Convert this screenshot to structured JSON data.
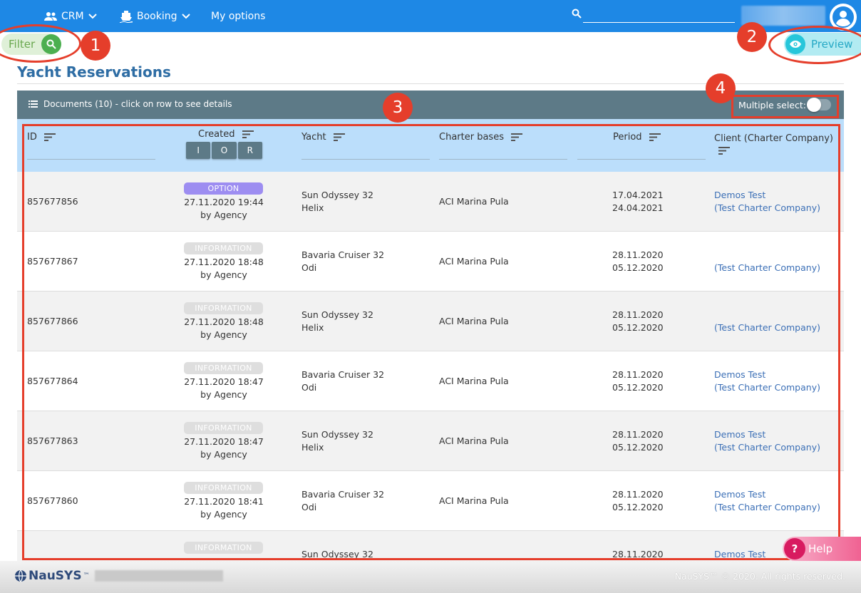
{
  "nav": {
    "crm": "CRM",
    "booking": "Booking",
    "my_options": "My options",
    "search_placeholder": ""
  },
  "filter_label": "Filter",
  "preview_label": "Preview",
  "page_title": "Yacht Reservations",
  "documents_label": "Documents (10) - click on row to see details",
  "multiple_select_label": "Multiple select:",
  "multiple_select_on": false,
  "columns": {
    "id": "ID",
    "created": "Created",
    "yacht": "Yacht",
    "bases": "Charter bases",
    "period": "Period",
    "client": "Client (Charter Company)"
  },
  "ior": [
    "I",
    "O",
    "R"
  ],
  "rows": [
    {
      "id": "857677856",
      "badge": "OPTION",
      "date": "27.11.2020 19:44",
      "by": "by Agency",
      "yacht_model": "Sun Odyssey 32",
      "yacht_name": "Helix",
      "base": "ACI Marina Pula",
      "from": "17.04.2021",
      "to": "24.04.2021",
      "client": "Demos Test",
      "company": "(Test Charter Company)"
    },
    {
      "id": "857677867",
      "badge": "INFORMATION",
      "date": "27.11.2020 18:48",
      "by": "by Agency",
      "yacht_model": "Bavaria Cruiser 32",
      "yacht_name": "Odi",
      "base": "ACI Marina Pula",
      "from": "28.11.2020",
      "to": "05.12.2020",
      "client": "",
      "company": "(Test Charter Company)"
    },
    {
      "id": "857677866",
      "badge": "INFORMATION",
      "date": "27.11.2020 18:48",
      "by": "by Agency",
      "yacht_model": "Sun Odyssey 32",
      "yacht_name": "Helix",
      "base": "ACI Marina Pula",
      "from": "28.11.2020",
      "to": "05.12.2020",
      "client": "",
      "company": "(Test Charter Company)"
    },
    {
      "id": "857677864",
      "badge": "INFORMATION",
      "date": "27.11.2020 18:47",
      "by": "by Agency",
      "yacht_model": "Bavaria Cruiser 32",
      "yacht_name": "Odi",
      "base": "ACI Marina Pula",
      "from": "28.11.2020",
      "to": "05.12.2020",
      "client": "Demos Test",
      "company": "(Test Charter Company)"
    },
    {
      "id": "857677863",
      "badge": "INFORMATION",
      "date": "27.11.2020 18:47",
      "by": "by Agency",
      "yacht_model": "Sun Odyssey 32",
      "yacht_name": "Helix",
      "base": "ACI Marina Pula",
      "from": "28.11.2020",
      "to": "05.12.2020",
      "client": "Demos Test",
      "company": "(Test Charter Company)"
    },
    {
      "id": "857677860",
      "badge": "INFORMATION",
      "date": "27.11.2020 18:41",
      "by": "by Agency",
      "yacht_model": "Bavaria Cruiser 32",
      "yacht_name": "Odi",
      "base": "ACI Marina Pula",
      "from": "28.11.2020",
      "to": "05.12.2020",
      "client": "Demos Test",
      "company": "(Test Charter Company)"
    },
    {
      "id": "",
      "badge": "INFORMATION",
      "date": "",
      "by": "",
      "yacht_model": "Sun Odyssey 32",
      "yacht_name": "",
      "base": "",
      "from": "28.11.2020",
      "to": "",
      "client": "Demos Test",
      "company": ""
    }
  ],
  "annotations": [
    "1",
    "2",
    "3",
    "4"
  ],
  "help_label": "Help",
  "help_icon": "?",
  "logo_text": "NauSYS",
  "logo_tm": "™",
  "copyright": "NauSYS™ © 2020. All rights reserved.",
  "colors": {
    "topbar": "#1e88e5",
    "table_header": "#bbdefb",
    "documents_bar": "#5d7a87",
    "annotation": "#e53e2b",
    "option_badge": "#9d8df1",
    "client_link": "#3b6fb6",
    "title": "#2e6da4"
  }
}
